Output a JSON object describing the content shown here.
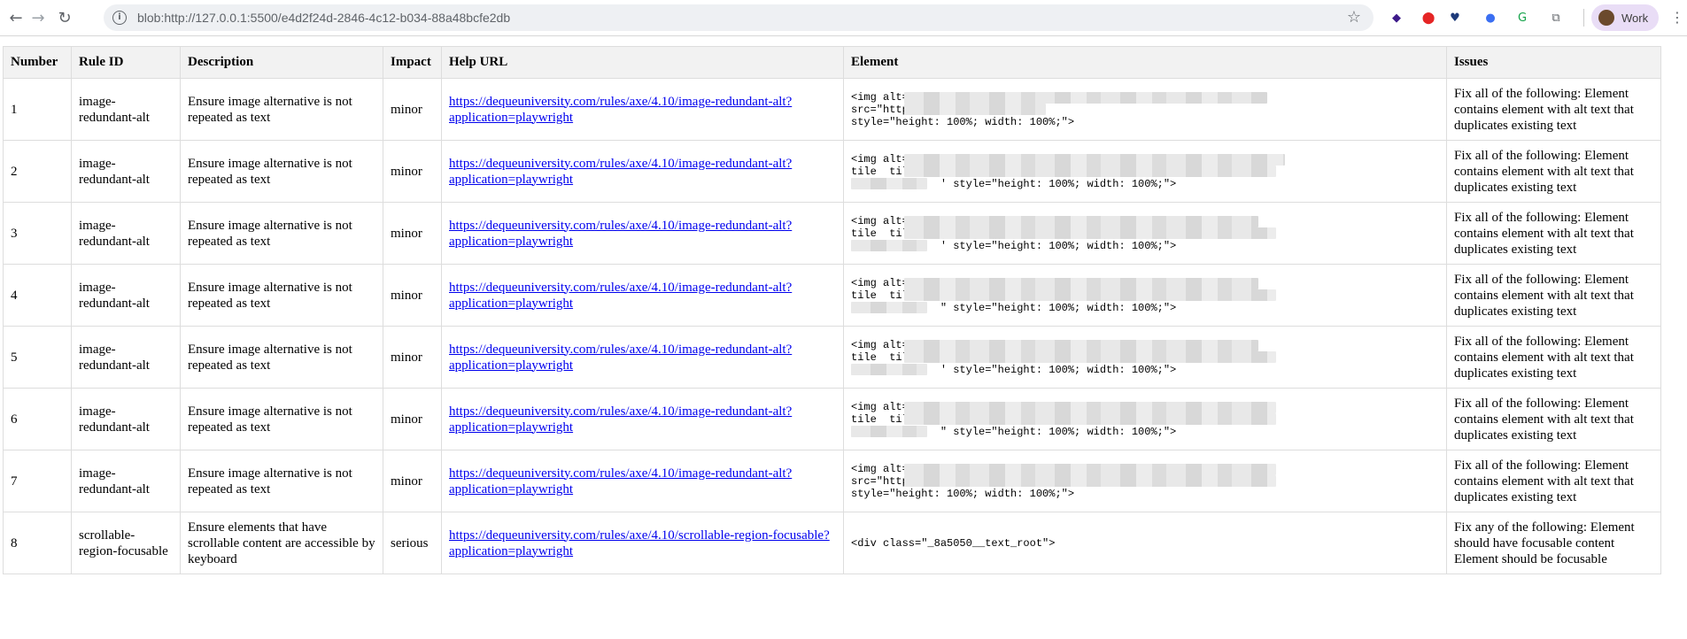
{
  "browser": {
    "url": "blob:http://127.0.0.1:5500/e4d2f24d-2846-4c12-b034-88a48bcfe2db",
    "profile_name": "Work"
  },
  "table": {
    "headers": [
      "Number",
      "Rule ID",
      "Description",
      "Impact",
      "Help URL",
      "Element",
      "Issues"
    ],
    "rows": [
      {
        "number": "1",
        "rule_id": "image-redundant-alt",
        "description": "Ensure image alternative is not repeated as text",
        "impact": "minor",
        "help_url": "https://dequeuniversity.com/rules/axe/4.10/image-redundant-alt?application=playwright",
        "element": "<img alt=\"\nsrc=\"https\nstyle=\"height: 100%; width: 100%;\">",
        "issues": "Fix all of the following: Element contains  element with alt text that duplicates existing text"
      },
      {
        "number": "2",
        "rule_id": "image-redundant-alt",
        "description": "Ensure image alternative is not repeated as text",
        "impact": "minor",
        "help_url": "https://dequeuniversity.com/rules/axe/4.10/image-redundant-alt?application=playwright",
        "element": "<img alt=\"\ntile  tile\n              ' style=\"height: 100%; width: 100%;\">",
        "issues": "Fix all of the following: Element contains  element with alt text that duplicates existing text"
      },
      {
        "number": "3",
        "rule_id": "image-redundant-alt",
        "description": "Ensure image alternative is not repeated as text",
        "impact": "minor",
        "help_url": "https://dequeuniversity.com/rules/axe/4.10/image-redundant-alt?application=playwright",
        "element": "<img alt=\"\ntile  tile\n              ' style=\"height: 100%; width: 100%;\">",
        "issues": "Fix all of the following: Element contains  element with alt text that duplicates existing text"
      },
      {
        "number": "4",
        "rule_id": "image-redundant-alt",
        "description": "Ensure image alternative is not repeated as text",
        "impact": "minor",
        "help_url": "https://dequeuniversity.com/rules/axe/4.10/image-redundant-alt?application=playwright",
        "element": "<img alt=\"!\ntile  tileI\n              \" style=\"height: 100%; width: 100%;\">",
        "issues": "Fix all of the following: Element contains  element with alt text that duplicates existing text"
      },
      {
        "number": "5",
        "rule_id": "image-redundant-alt",
        "description": "Ensure image alternative is not repeated as text",
        "impact": "minor",
        "help_url": "https://dequeuniversity.com/rules/axe/4.10/image-redundant-alt?application=playwright",
        "element": "<img alt=\"(\ntile  tileI\n              ' style=\"height: 100%; width: 100%;\">",
        "issues": "Fix all of the following: Element contains  element with alt text that duplicates existing text"
      },
      {
        "number": "6",
        "rule_id": "image-redundant-alt",
        "description": "Ensure image alternative is not repeated as text",
        "impact": "minor",
        "help_url": "https://dequeuniversity.com/rules/axe/4.10/image-redundant-alt?application=playwright",
        "element": "<img alt=\"\ntile  tile\n              \" style=\"height: 100%; width: 100%;\">",
        "issues": "Fix all of the following: Element contains  element with alt text that duplicates existing text"
      },
      {
        "number": "7",
        "rule_id": "image-redundant-alt",
        "description": "Ensure image alternative is not repeated as text",
        "impact": "minor",
        "help_url": "https://dequeuniversity.com/rules/axe/4.10/image-redundant-alt?application=playwright",
        "element": "<img alt=\"\nsrc=\"https\nstyle=\"height: 100%; width: 100%;\">",
        "issues": "Fix all of the following: Element contains  element with alt text that duplicates existing text"
      },
      {
        "number": "8",
        "rule_id": "scrollable-region-focusable",
        "description": "Ensure elements that have scrollable content are accessible by keyboard",
        "impact": "serious",
        "help_url": "https://dequeuniversity.com/rules/axe/4.10/scrollable-region-focusable?application=playwright",
        "element": "<div class=\"_8a5050__text_root\">",
        "issues": "Fix any of the following: Element should have focusable content Element should be focusable"
      }
    ]
  },
  "icons": [
    "back-arrow-icon",
    "forward-arrow-icon",
    "reload-icon",
    "info-icon",
    "bookmark-star-icon",
    "extension-icon",
    "profile-avatar-icon",
    "menu-kebab-icon"
  ]
}
